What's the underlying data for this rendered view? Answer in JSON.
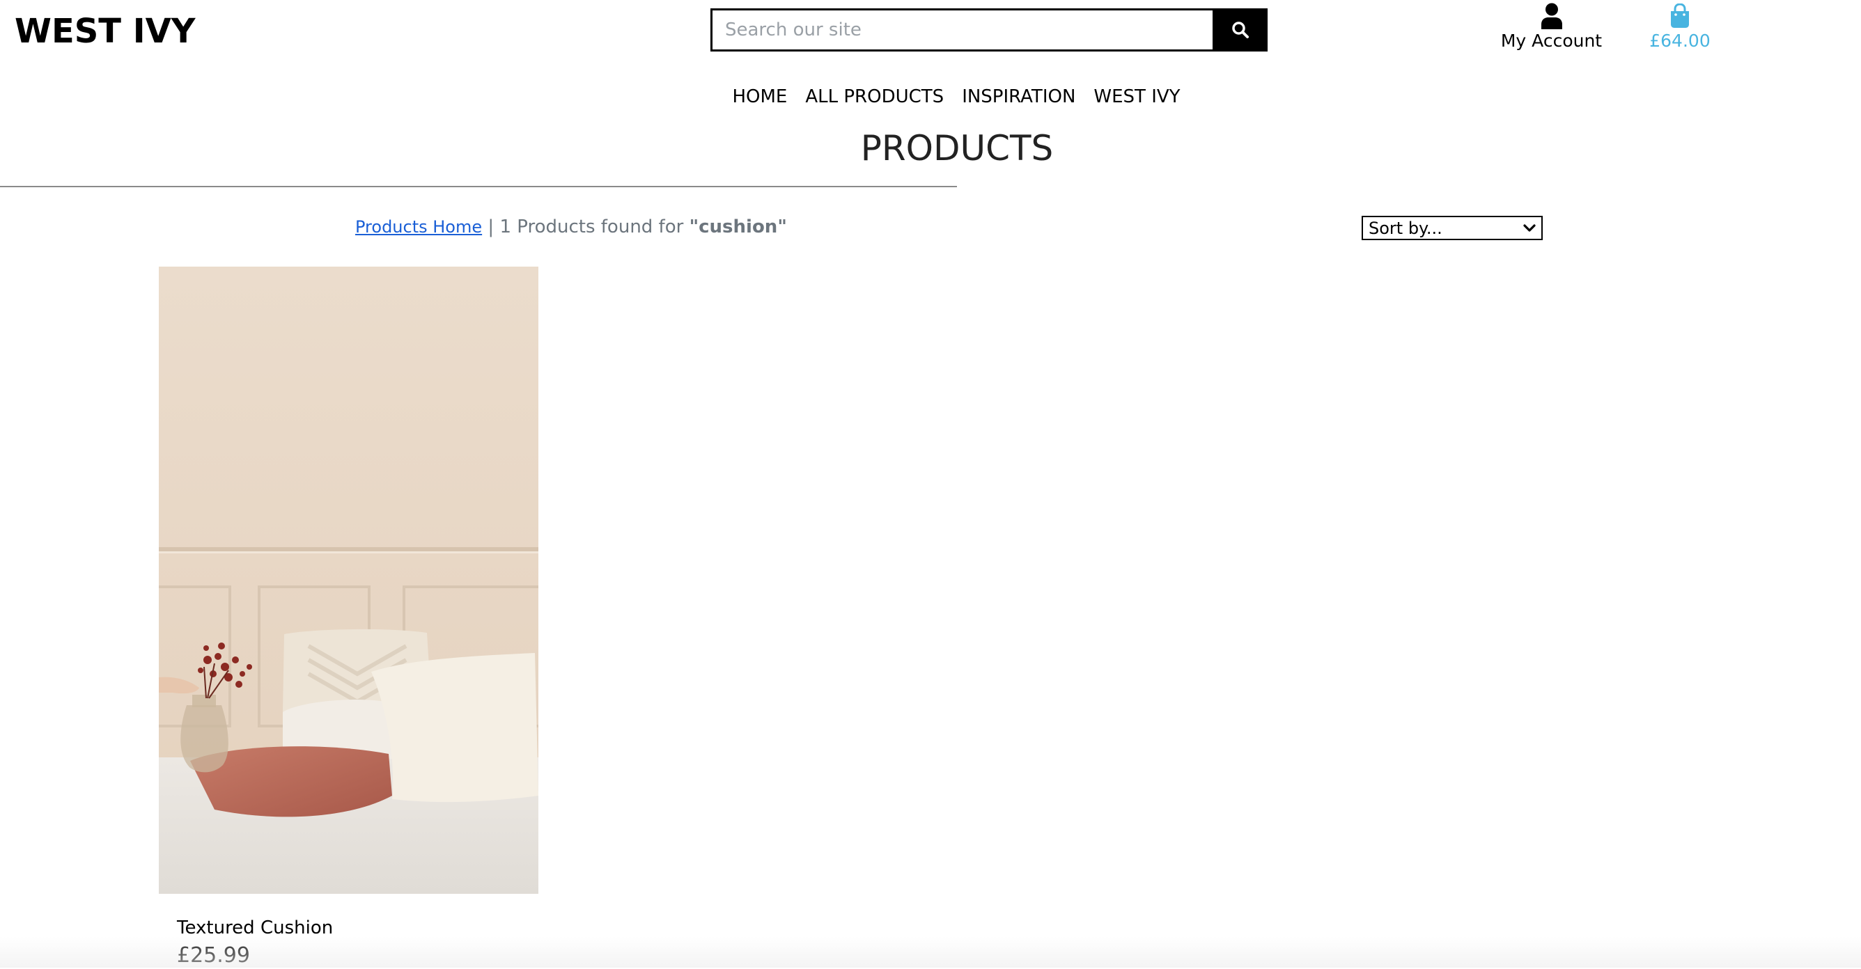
{
  "header": {
    "logo_text": "WEST IVY",
    "search": {
      "placeholder": "Search our site",
      "value": ""
    },
    "account_label": "My Account",
    "bag_total": "£64.00"
  },
  "nav": {
    "items": [
      {
        "label": "HOME"
      },
      {
        "label": "ALL PRODUCTS"
      },
      {
        "label": "INSPIRATION"
      },
      {
        "label": "WEST IVY"
      }
    ]
  },
  "page": {
    "title": "PRODUCTS"
  },
  "results": {
    "home_link": "Products Home",
    "separator": "|",
    "count_text": "1 Products found for",
    "query": "\"cushion\""
  },
  "sort": {
    "selected": "Sort by..."
  },
  "products": [
    {
      "name": "Textured Cushion",
      "price": "£25.99"
    }
  ],
  "colors": {
    "brand_accent": "#48b4e0",
    "link": "#1a5fd6",
    "muted_text": "#6c757d"
  },
  "icons": {
    "search": "magnifier-icon",
    "account": "user-icon",
    "bag": "shopping-bag-icon",
    "sort": "chevron-down-icon"
  }
}
